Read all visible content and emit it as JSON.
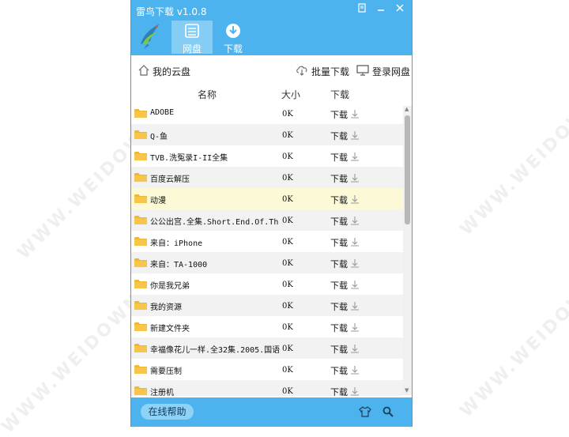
{
  "app": {
    "title": "雷鸟下载 v1.0.8"
  },
  "tabs": [
    {
      "label": "网盘",
      "active": true
    },
    {
      "label": "下载",
      "active": false
    }
  ],
  "toolbar": {
    "my_cloud": "我的云盘",
    "batch_download": "批量下载",
    "login_disk": "登录网盘"
  },
  "columns": {
    "name": "名称",
    "size": "大小",
    "download": "下载"
  },
  "files": [
    {
      "name": "ADOBE",
      "size": "0K",
      "action": "下载"
    },
    {
      "name": "Q-鱼",
      "size": "0K",
      "action": "下载"
    },
    {
      "name": "TVB.洗冤录I-II全集",
      "size": "0K",
      "action": "下载"
    },
    {
      "name": "百度云解压",
      "size": "0K",
      "action": "下载"
    },
    {
      "name": "动漫",
      "size": "0K",
      "action": "下载"
    },
    {
      "name": "公公出宫.全集.Short.End.Of.Th",
      "size": "0K",
      "action": "下载"
    },
    {
      "name": "来自：iPhone",
      "size": "0K",
      "action": "下载"
    },
    {
      "name": "来自：TA-1000",
      "size": "0K",
      "action": "下载"
    },
    {
      "name": "你是我兄弟",
      "size": "0K",
      "action": "下载"
    },
    {
      "name": "我的资源",
      "size": "0K",
      "action": "下载"
    },
    {
      "name": "新建文件夹",
      "size": "0K",
      "action": "下载"
    },
    {
      "name": "幸福像花儿一样.全32集.2005.国语",
      "size": "0K",
      "action": "下载"
    },
    {
      "name": "需要压制",
      "size": "0K",
      "action": "下载"
    },
    {
      "name": "注册机",
      "size": "0K",
      "action": "下载"
    }
  ],
  "footer": {
    "help": "在线帮助"
  },
  "watermark": "WWW.WEIDOWN.COM",
  "colors": {
    "accent": "#4db3ee",
    "highlight_row": "#fbf9d6",
    "folder": "#f2b632"
  },
  "icons": [
    "skin-icon",
    "minimize-icon",
    "close-icon",
    "bird-logo-icon",
    "disk-icon",
    "download-circle-icon",
    "home-icon",
    "cloud-download-icon",
    "monitor-icon",
    "folder-icon",
    "download-arrow-icon",
    "shirt-icon",
    "search-icon"
  ]
}
